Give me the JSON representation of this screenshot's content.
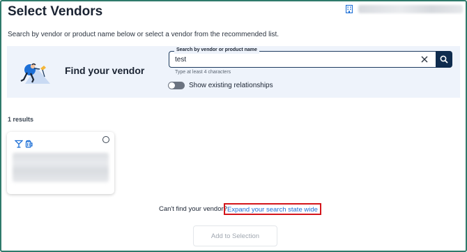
{
  "header": {
    "title": "Select Vendors",
    "org_icon": "building-icon"
  },
  "subtitle": "Search by vendor or product name below or select a vendor from the recommended list.",
  "find_panel": {
    "heading": "Find your vendor",
    "illustration": "person-searching-illustration",
    "search": {
      "label": "Search by vendor or product name",
      "value": "test",
      "hint": "Type at least 4 characters",
      "clear_icon": "close-icon",
      "search_icon": "search-icon"
    },
    "toggle": {
      "label": "Show existing relationships",
      "checked": false
    }
  },
  "results": {
    "count_label": "1 results",
    "cards": [
      {
        "icons": [
          "cocktail-icon",
          "beer-mug-icon"
        ],
        "selected": false
      }
    ]
  },
  "footer": {
    "cant_find_text": "Can't find your vendor?",
    "expand_link": "Expand your search state wide",
    "add_button": "Add to Selection"
  },
  "colors": {
    "frame": "#2f7a6b",
    "panel_bg": "#eef3fb",
    "search_button": "#0f2c4e",
    "link": "#1d6fd6",
    "highlight": "#d4151b"
  }
}
